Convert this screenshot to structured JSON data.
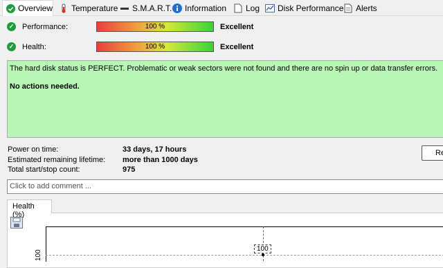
{
  "tabs": [
    {
      "label": "Overview",
      "icon": "check-circle-icon"
    },
    {
      "label": "Temperature",
      "icon": "thermometer-icon"
    },
    {
      "label": "S.M.A.R.T.",
      "icon": "dash-icon"
    },
    {
      "label": "Information",
      "icon": "info-icon"
    },
    {
      "label": "Log",
      "icon": "document-icon"
    },
    {
      "label": "Disk Performance",
      "icon": "chart-icon"
    },
    {
      "label": "Alerts",
      "icon": "alert-document-icon"
    }
  ],
  "performance": {
    "label": "Performance:",
    "percent": "100 %",
    "fill": 1.0,
    "rating": "Excellent"
  },
  "health": {
    "label": "Health:",
    "percent": "100 %",
    "fill": 1.0,
    "rating": "Excellent"
  },
  "status": {
    "message": "The hard disk status is PERFECT. Problematic or weak sectors were not found and there are no spin up or data transfer errors.",
    "action": "No actions needed."
  },
  "info": [
    {
      "label": "Power on time:",
      "value": "33 days, 17 hours"
    },
    {
      "label": "Estimated remaining lifetime:",
      "value": "more than 1000 days"
    },
    {
      "label": "Total start/stop count:",
      "value": "975"
    }
  ],
  "right_button": {
    "label": "Re"
  },
  "comment": {
    "placeholder": "Click to add comment ..."
  },
  "chart_tab": {
    "label": "Health (%)"
  },
  "chart": {
    "point_label": "100",
    "y_tick": "100"
  },
  "colors": {
    "status_bg": "#b9f6b5",
    "bar_low": "#e8403c",
    "bar_high": "#39d23c",
    "check_green": "#1e9b3a"
  }
}
